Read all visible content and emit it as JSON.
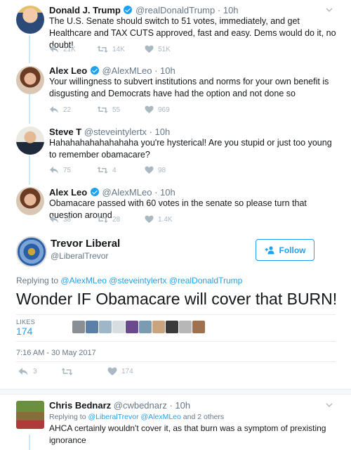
{
  "tweets": [
    {
      "name": "Donald J. Trump",
      "verified": true,
      "handle": "@realDonaldTrump",
      "time": "10h",
      "text": "The U.S. Senate should switch to 51 votes, immediately, and get Healthcare and TAX CUTS approved, fast and easy. Dems would do it, no doubt!",
      "replies": "21K",
      "retweets": "14K",
      "likes": "51K"
    },
    {
      "name": "Alex Leo",
      "verified": true,
      "handle": "@AlexMLeo",
      "time": "10h",
      "text": "Your willingness to subvert institutions and norms for your own benefit is disgusting and Democrats have had the option and not done so",
      "replies": "22",
      "retweets": "55",
      "likes": "969"
    },
    {
      "name": "Steve T",
      "verified": false,
      "handle": "@steveintylertx",
      "time": "10h",
      "text": "Hahahahahahahahaha you're hysterical! Are you stupid or just too young to remember obamacare?",
      "replies": "75",
      "retweets": "4",
      "likes": "98"
    },
    {
      "name": "Alex Leo",
      "verified": true,
      "handle": "@AlexMLeo",
      "time": "10h",
      "text": "Obamacare passed with 60 votes in the senate so please turn that question around",
      "replies": "38",
      "retweets": "28",
      "likes": "1.4K"
    }
  ],
  "focused": {
    "name": "Trevor Liberal",
    "handle": "@LiberalTrevor",
    "follow_label": "Follow",
    "replying_prefix": "Replying to",
    "replying_to": [
      "@AlexMLeo",
      "@steveintylertx",
      "@realDonaldTrump"
    ],
    "text": "Wonder IF Obamacare will cover that BURN!",
    "likes_label": "LIKES",
    "likes_count": "174",
    "timestamp": "7:16 AM - 30 May 2017",
    "replies": "3",
    "retweets": "",
    "likes": "174",
    "liker_colors": [
      "#8a8f96",
      "#5b7fa6",
      "#9fb6c9",
      "#d8dde2",
      "#6a4a8c",
      "#7a9bb0",
      "#c9a47e",
      "#3b3b3b",
      "#b7b7b7",
      "#a0714f"
    ]
  },
  "reply": {
    "name": "Chris Bednarz",
    "handle": "@cwbednarz",
    "time": "10h",
    "replying_prefix": "Replying to",
    "replying_to": [
      "@LiberalTrevor",
      "@AlexMLeo"
    ],
    "replying_suffix": "and 2 others",
    "text": "AHCA certainly wouldn't cover it, as that burn was a symptom of prexisting ignorance"
  },
  "colors": {
    "accent": "#1da1f2",
    "muted": "#657786",
    "icon": "#aab8c2",
    "thread": "#c4ecfd"
  },
  "icons": {
    "reply": "reply-icon",
    "retweet": "retweet-icon",
    "like": "heart-icon",
    "caret": "chevron-down-icon",
    "verified": "verified-badge-icon",
    "follow": "add-user-icon"
  }
}
